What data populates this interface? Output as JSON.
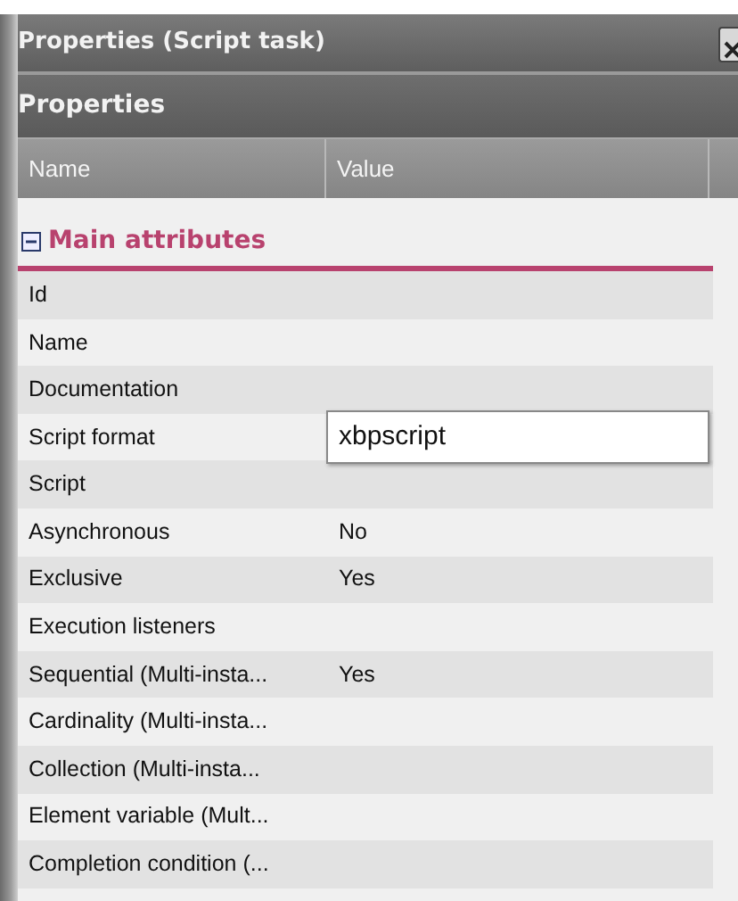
{
  "window": {
    "title": "Properties (Script task)"
  },
  "panel": {
    "title": "Properties"
  },
  "table": {
    "columns": [
      "Name",
      "Value"
    ]
  },
  "group": {
    "title": "Main attributes",
    "expanded": true,
    "rows": [
      {
        "name": "Id",
        "editing": false
      },
      {
        "name": "Name",
        "editing": false
      },
      {
        "name": "Documentation",
        "editing": false
      },
      {
        "name": "Script format",
        "value": "xbpscript",
        "editing": true
      },
      {
        "name": "Script",
        "editing": false
      },
      {
        "name": "Asynchronous",
        "value": "No",
        "editing": false
      },
      {
        "name": "Exclusive",
        "value": "Yes",
        "editing": false
      },
      {
        "name": "Execution listeners",
        "editing": false
      },
      {
        "name": "Sequential (Multi-insta...",
        "value": "Yes",
        "editing": false
      },
      {
        "name": "Cardinality (Multi-insta...",
        "editing": false
      },
      {
        "name": "Collection (Multi-insta...",
        "editing": false
      },
      {
        "name": "Element variable (Mult...",
        "editing": false
      },
      {
        "name": "Completion condition (...",
        "editing": false
      }
    ]
  }
}
